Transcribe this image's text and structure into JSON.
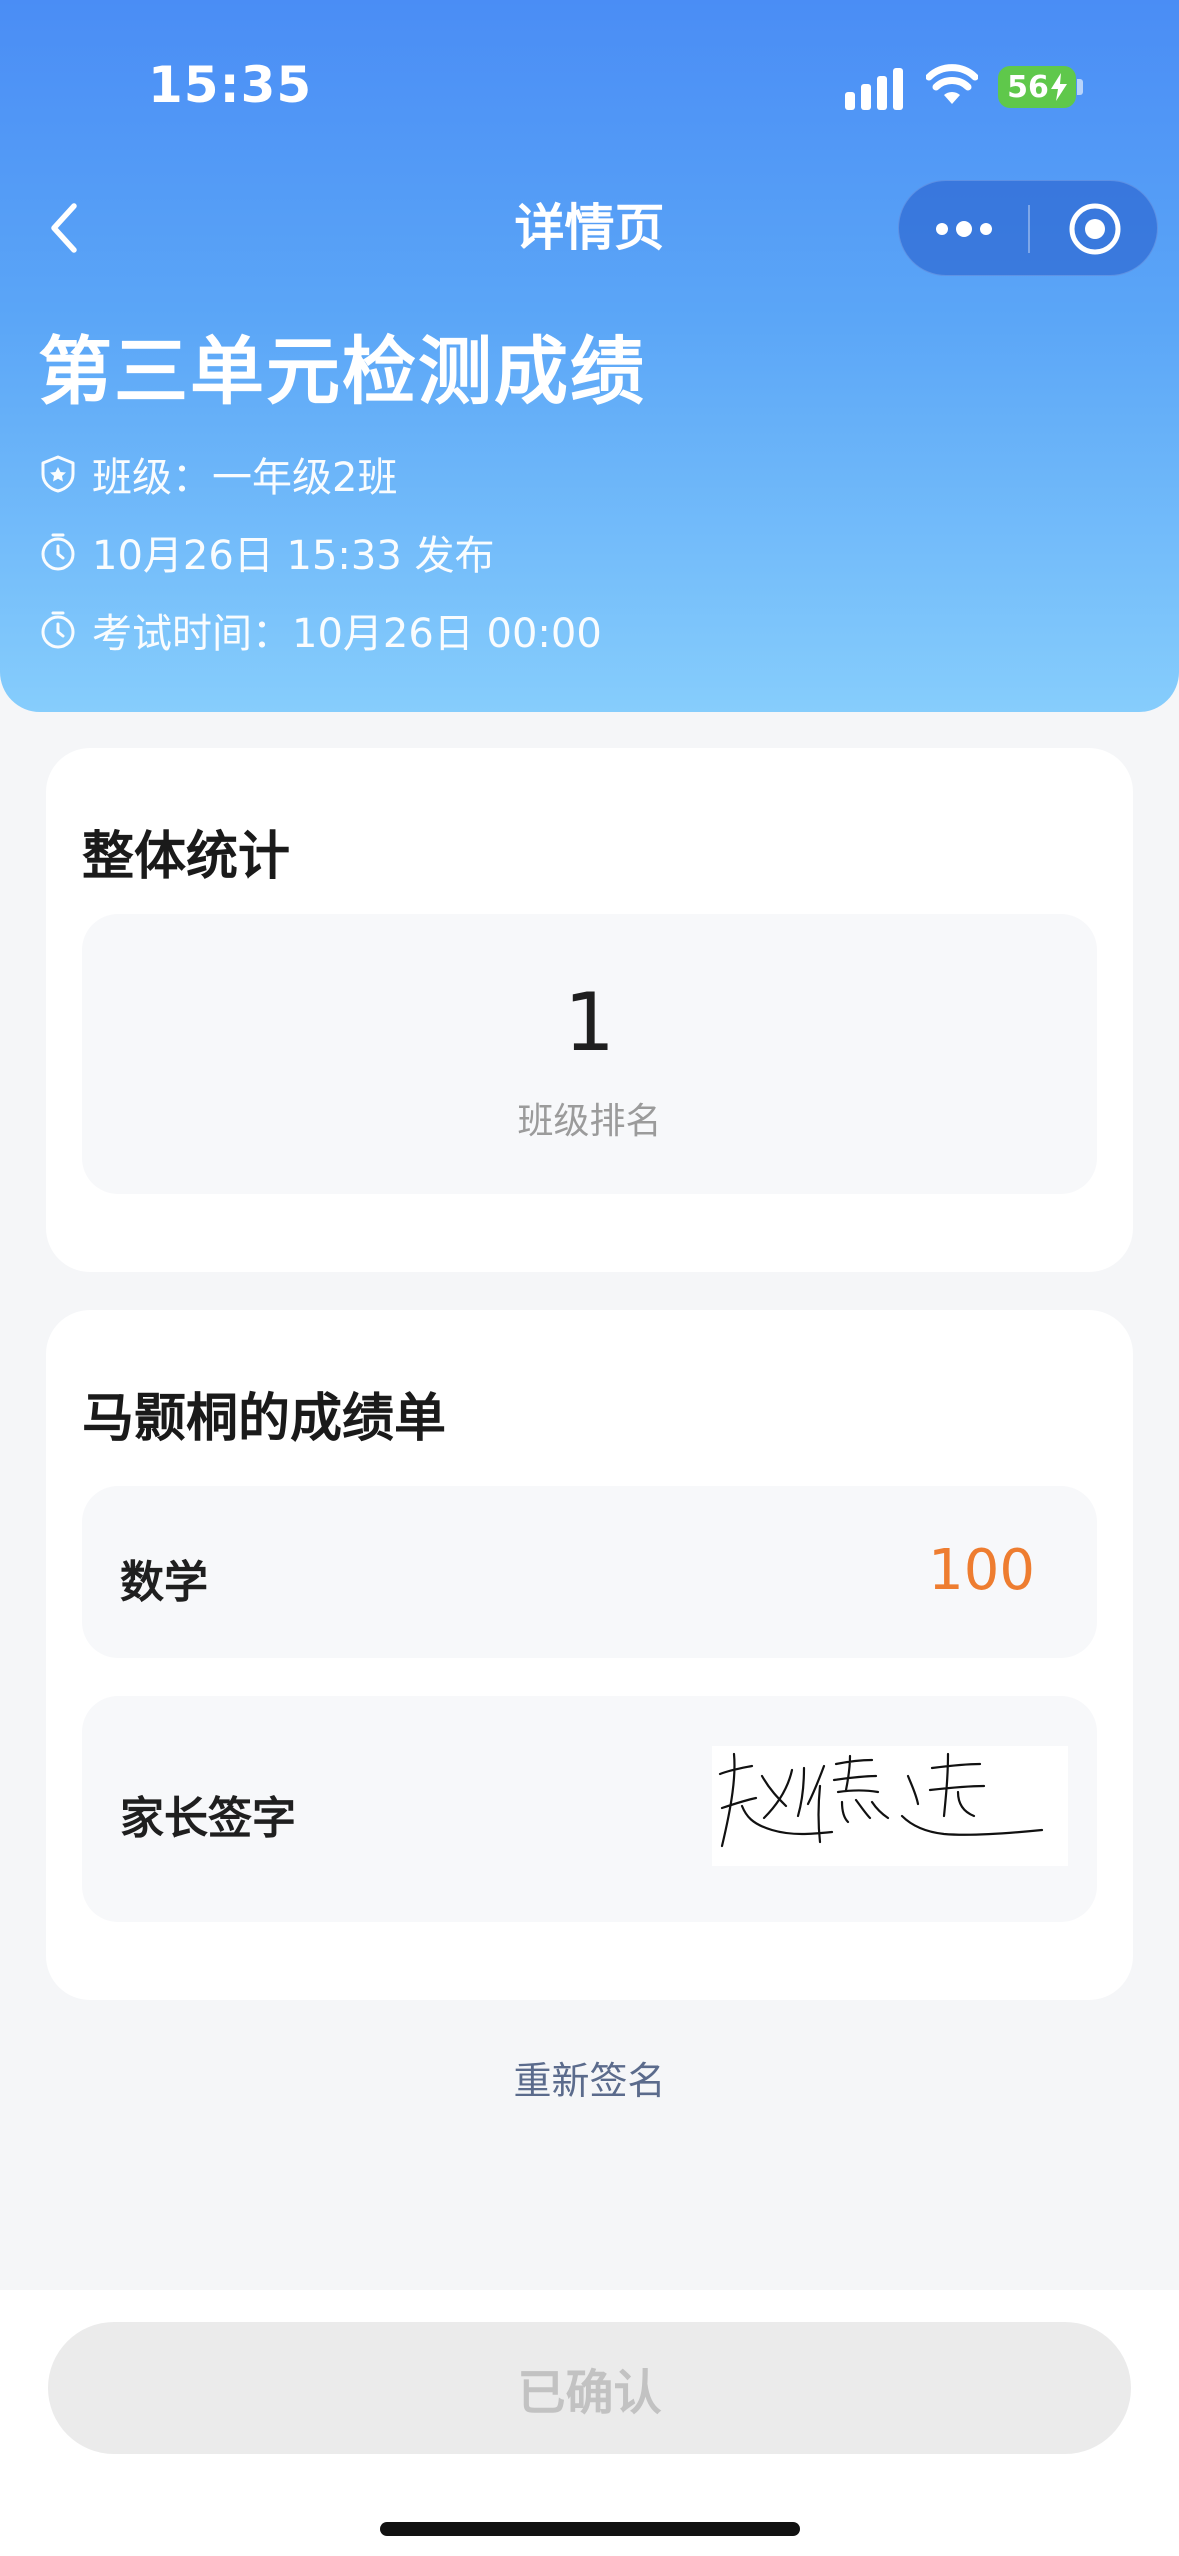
{
  "status_bar": {
    "time": "15:35",
    "battery": "56",
    "icons": [
      "signal-icon",
      "wifi-icon",
      "charging-bolt-icon"
    ]
  },
  "nav": {
    "title": "详情页",
    "icons": [
      "back-chevron-icon",
      "more-dots-icon",
      "close-target-icon"
    ]
  },
  "header": {
    "title": "第三单元检测成绩",
    "class_info": "班级：一年级2班",
    "publish_info": "10月26日 15:33 发布",
    "exam_time": "考试时间：10月26日 00:00",
    "icons": [
      "shield-icon",
      "clock-icon",
      "clock-icon"
    ]
  },
  "overall": {
    "title": "整体统计",
    "rank_value": "1",
    "rank_label": "班级排名"
  },
  "report": {
    "title": "马颢桐的成绩单",
    "subject_label": "数学",
    "subject_score": "100",
    "signature_label": "家长签字",
    "signature_text": "赵德连"
  },
  "actions": {
    "resign": "重新签名",
    "confirm": "已确认"
  },
  "colors": {
    "header_gradient_top": "#4a8df5",
    "header_gradient_bottom": "#86cdfc",
    "score": "#ee7d30",
    "link": "#5b6b8c",
    "disabled_button": "#ebebeb"
  }
}
